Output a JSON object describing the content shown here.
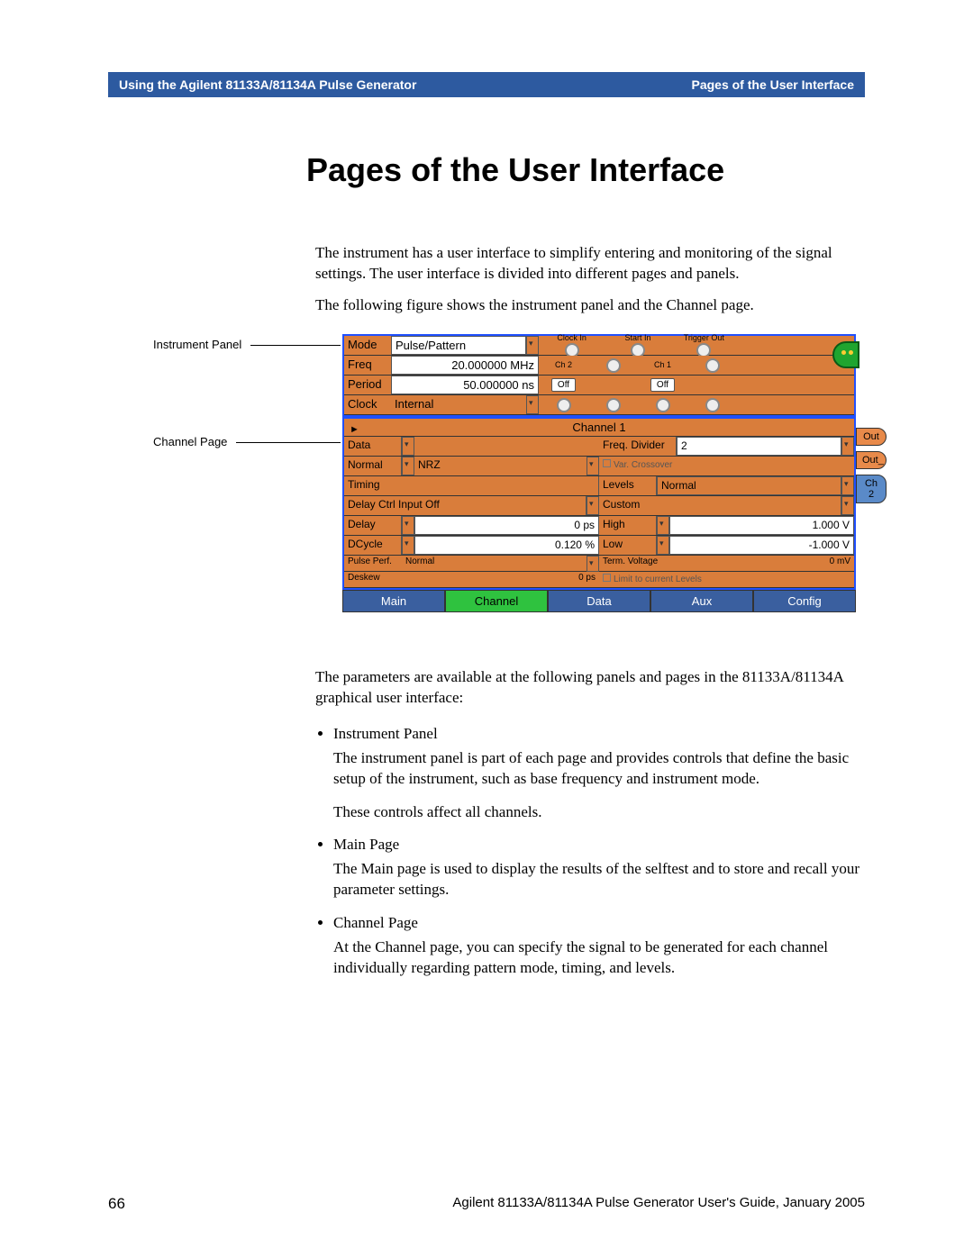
{
  "header": {
    "left": "Using the Agilent 81133A/81134A Pulse Generator",
    "right": "Pages of the User Interface"
  },
  "title": "Pages of the User Interface",
  "intro": {
    "p1": "The instrument has a user interface to simplify entering and monitoring of the signal settings. The user interface is divided into different pages and panels.",
    "p2": "The following figure shows the instrument panel and the Channel page."
  },
  "callouts": {
    "instrument_panel": "Instrument Panel",
    "channel_page": "Channel Page"
  },
  "instrument_panel": {
    "mode_label": "Mode",
    "mode_value": "Pulse/Pattern",
    "freq_label": "Freq",
    "freq_value": "20.000000 MHz",
    "period_label": "Period",
    "period_value": "50.000000 ns",
    "clock_label": "Clock",
    "clock_value": "Internal",
    "io": {
      "clock_in": "Clock In",
      "start_in": "Start In",
      "trigger_out": "Trigger Out",
      "ch2": "Ch 2",
      "ch1": "Ch 1",
      "off": "Off"
    }
  },
  "channel_panel": {
    "header": "Channel 1",
    "side": {
      "out": "Out",
      "out_": "Out_",
      "ch2": "Ch 2"
    },
    "left": {
      "data_label": "Data",
      "normal_label": "Normal",
      "nrz": "NRZ",
      "timing_label": "Timing",
      "delay_ctrl": "Delay Ctrl Input Off",
      "delay_label": "Delay",
      "delay_value": "0 ps",
      "dcycle_label": "DCycle",
      "dcycle_value": "0.120 %",
      "pulse_perf_label": "Pulse Perf.",
      "pulse_perf_value": "Normal",
      "deskew_label": "Deskew",
      "deskew_value": "0 ps"
    },
    "right": {
      "freq_div_label": "Freq. Divider",
      "freq_div_value": "2",
      "var_crossover": "Var. Crossover",
      "levels_label": "Levels",
      "levels_mode": "Normal",
      "custom_label": "Custom",
      "high_label": "High",
      "high_value": "1.000 V",
      "low_label": "Low",
      "low_value": "-1.000 V",
      "term_v_label": "Term. Voltage",
      "term_v_value": "0 mV",
      "limit_label": "Limit to current Levels"
    }
  },
  "tabs": {
    "main": "Main",
    "channel": "Channel",
    "data": "Data",
    "aux": "Aux",
    "config": "Config"
  },
  "after_figure": "The parameters are available at the following panels and pages in the 81133A/81134A graphical user interface:",
  "bullets": {
    "b1_title": "Instrument Panel",
    "b1_body1": "The instrument panel is part of each page and provides controls that define the basic setup of the instrument, such as base frequency and instrument mode.",
    "b1_body2": "These controls affect all channels.",
    "b2_title": "Main Page",
    "b2_body": "The Main page is used to display the results of the selftest and to store and recall your parameter settings.",
    "b3_title": "Channel Page",
    "b3_body": "At the Channel page, you can specify the signal to be generated for each channel individually regarding pattern mode, timing, and levels."
  },
  "footer": {
    "page_number": "66",
    "text": "Agilent 81133A/81134A Pulse Generator User's Guide, January 2005"
  }
}
